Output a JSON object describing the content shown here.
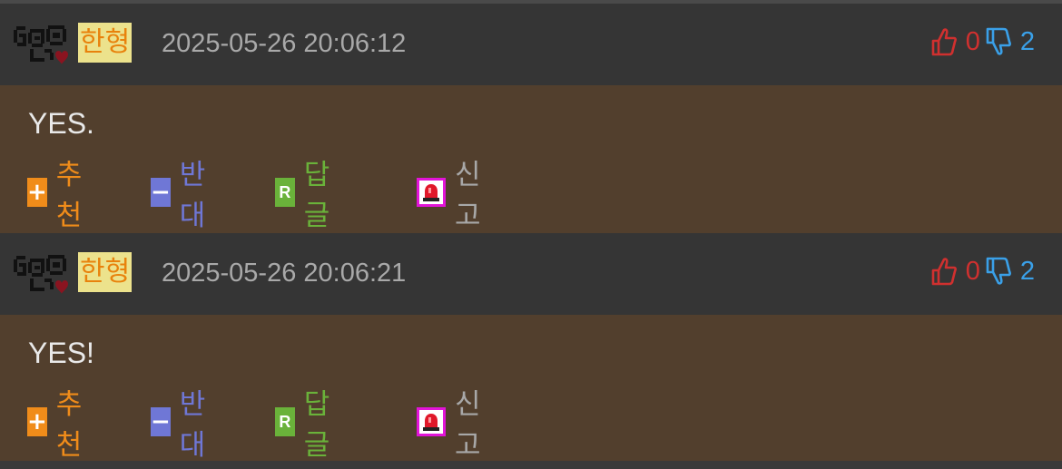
{
  "comments": [
    {
      "nickname": "한형",
      "timestamp": "2025-05-26 20:06:12",
      "upvotes": "0",
      "downvotes": "2",
      "text": "YES."
    },
    {
      "nickname": "한형",
      "timestamp": "2025-05-26 20:06:21",
      "upvotes": "0",
      "downvotes": "2",
      "text": "YES!"
    }
  ],
  "actions": {
    "recommend": "추천",
    "oppose": "반대",
    "reply": "답글",
    "report": "신고",
    "recommend_symbol": "+",
    "oppose_symbol": "−",
    "reply_symbol": "R"
  },
  "icons": {
    "avatar": "pixel-avatar-icon",
    "upvote": "thumbs-up-icon",
    "downvote": "thumbs-down-icon",
    "report": "siren-icon"
  },
  "colors": {
    "header_bg": "#353535",
    "body_bg": "#523f2d",
    "nickname_bg": "#ece28c",
    "nickname_text": "#e8820c",
    "upvote": "#d0302f",
    "downvote": "#3aa0e8",
    "recommend": "#f08c1a",
    "oppose": "#6f77d6",
    "reply": "#6ab23a",
    "report": "#e214d8"
  }
}
